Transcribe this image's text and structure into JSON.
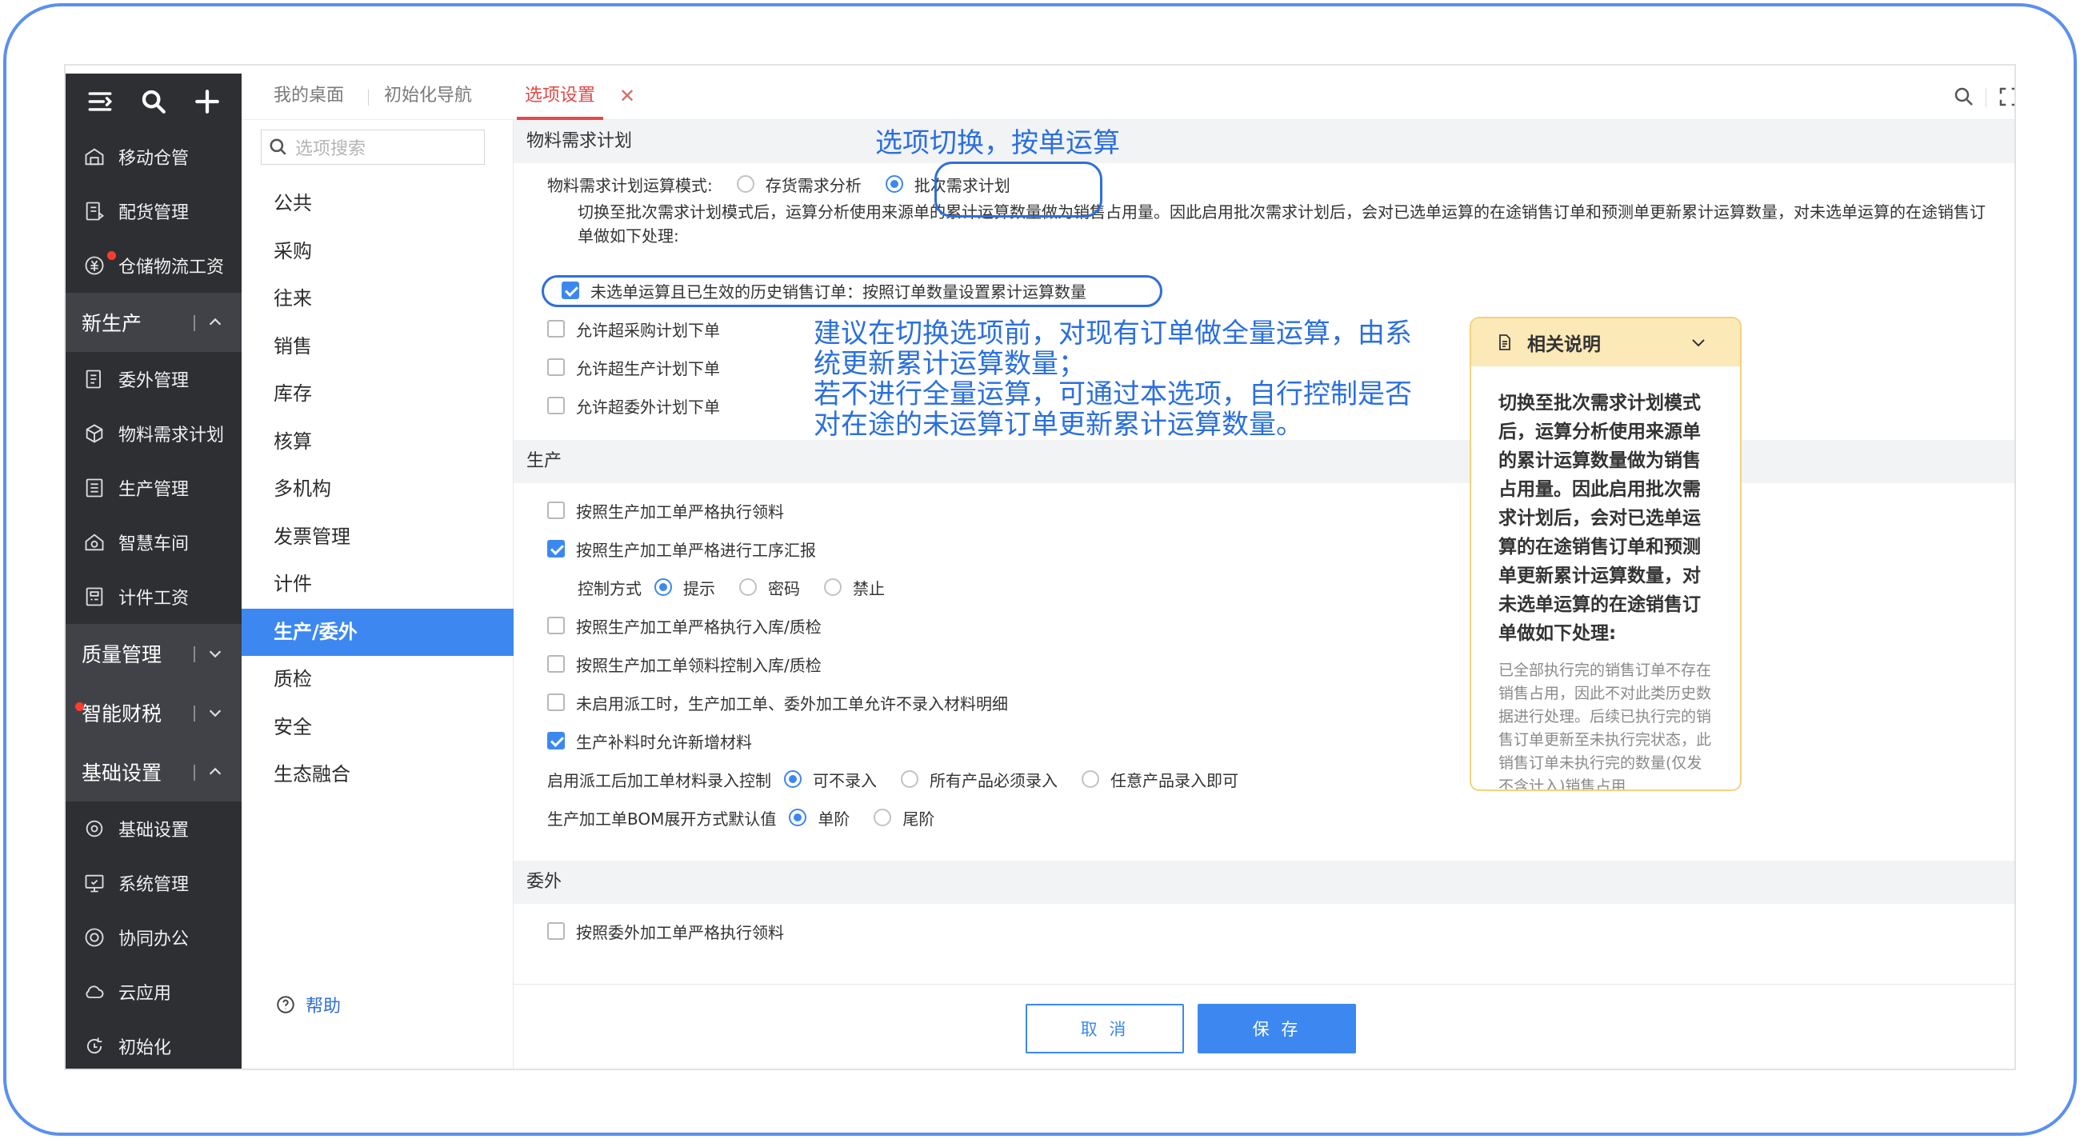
{
  "sidebar": {
    "items_top": [
      {
        "label": "移动仓管",
        "icon": "mobile-warehouse-icon"
      },
      {
        "label": "配货管理",
        "icon": "distribution-icon"
      },
      {
        "label": "仓储物流工资",
        "icon": "logistics-wage-icon",
        "dot": true
      }
    ],
    "group_new_production": "新生产",
    "items_production": [
      {
        "label": "委外管理",
        "icon": "outsource-icon"
      },
      {
        "label": "物料需求计划",
        "icon": "material-plan-icon"
      },
      {
        "label": "生产管理",
        "icon": "production-icon"
      },
      {
        "label": "智慧车间",
        "icon": "smart-workshop-icon"
      },
      {
        "label": "计件工资",
        "icon": "piece-wage-icon"
      }
    ],
    "group_quality": "质量管理",
    "group_finance": "智能财税",
    "group_basic": "基础设置",
    "items_basic": [
      {
        "label": "基础设置",
        "icon": "basic-settings-icon"
      },
      {
        "label": "系统管理",
        "icon": "system-admin-icon"
      },
      {
        "label": "协同办公",
        "icon": "collaboration-icon"
      },
      {
        "label": "云应用",
        "icon": "cloud-icon"
      },
      {
        "label": "初始化",
        "icon": "initialize-icon"
      }
    ]
  },
  "tabs": {
    "desktop": "我的桌面",
    "init_nav": "初始化导航",
    "options": "选项设置"
  },
  "search": {
    "placeholder": "选项搜索"
  },
  "nav": {
    "items": [
      "公共",
      "采购",
      "往来",
      "销售",
      "库存",
      "核算",
      "多机构",
      "发票管理",
      "计件",
      "生产/委外",
      "质检",
      "安全",
      "生态融合"
    ],
    "active_index": 9,
    "help": "帮助"
  },
  "mrp": {
    "title": "物料需求计划",
    "mode_label": "物料需求计划运算模式:",
    "mode_options": [
      "存货需求分析",
      "批次需求计划"
    ],
    "mode_selected": 1,
    "description": "切换至批次需求计划模式后，运算分析使用来源单的累计运算数量做为销售占用量。因此启用批次需求计划后，会对已选单运算的在途销售订单和预测单更新累计运算数量，对未选单运算的在途销售订单做如下处理:",
    "history_option": "未选单运算且已生效的历史销售订单：按照订单数量设置累计运算数量",
    "allow_purchase": "允许超采购计划下单",
    "allow_production": "允许超生产计划下单",
    "allow_outsource": "允许超委外计划下单"
  },
  "annotations": {
    "top": "选项切换，按单运算",
    "middle_line1": "建议在切换选项前，对现有订单做全量运算，由系",
    "middle_line2": "统更新累计运算数量；",
    "middle_line3": "若不进行全量运算，可通过本选项，自行控制是否",
    "middle_line4": "对在途的未运算订单更新累计运算数量。"
  },
  "production": {
    "title": "生产",
    "strict_issue": "按照生产加工单严格执行领料",
    "strict_report": "按照生产加工单严格进行工序汇报",
    "control_label": "控制方式",
    "control_options": [
      "提示",
      "密码",
      "禁止"
    ],
    "control_selected": 0,
    "strict_inbound": "按照生产加工单严格执行入库/质检",
    "issue_control_inbound": "按照生产加工单领料控制入库/质检",
    "no_dispatch": "未启用派工时，生产加工单、委外加工单允许不录入材料明细",
    "allow_add_material": "生产补料时允许新增材料",
    "dispatch_label": "启用派工后加工单材料录入控制",
    "dispatch_options": [
      "可不录入",
      "所有产品必须录入",
      "任意产品录入即可"
    ],
    "dispatch_selected": 0,
    "bom_label": "生产加工单BOM展开方式默认值",
    "bom_options": [
      "单阶",
      "尾阶"
    ],
    "bom_selected": 0
  },
  "outsource": {
    "title": "委外",
    "strict_issue": "按照委外加工单严格执行领料"
  },
  "card": {
    "title": "相关说明",
    "body": "切换至批次需求计划模式后，运算分析使用来源单的累计运算数量做为销售占用量。因此启用批次需求计划后，会对已选单运算的在途销售订单和预测单更新累计运算数量，对未选单运算的在途销售订单做如下处理:",
    "body2": "已全部执行完的销售订单不存在销售占用，因此不对此类历史数据进行处理。后续已执行完的销售订单更新至未执行完状态，此销售订单未执行完的数量(仅发不含计入)销售占用"
  },
  "footer": {
    "cancel": "取 消",
    "save": "保 存"
  },
  "colors": {
    "accent": "#3c88f0",
    "tab_active": "#e34848",
    "sidebar_bg": "#2e2f33",
    "annotation": "#2a6fdf",
    "card_head": "#fbe9b8"
  }
}
